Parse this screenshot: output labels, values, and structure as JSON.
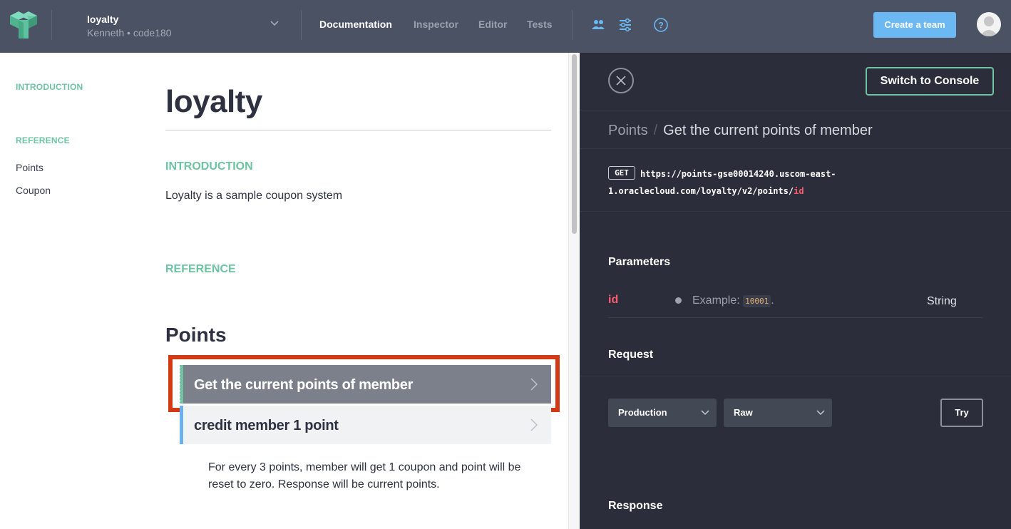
{
  "header": {
    "project_name": "loyalty",
    "project_subtitle": "Kenneth • code180",
    "nav": [
      "Documentation",
      "Inspector",
      "Editor",
      "Tests"
    ],
    "active_nav": "Documentation",
    "create_team_label": "Create a team",
    "icons": [
      "team-icon",
      "settings-sliders-icon",
      "help-icon"
    ]
  },
  "sidebar": {
    "intro_heading": "INTRODUCTION",
    "reference_heading": "REFERENCE",
    "items": [
      "Points",
      "Coupon"
    ]
  },
  "main": {
    "title": "loyalty",
    "intro_label": "INTRODUCTION",
    "intro_text": "Loyalty is a sample coupon system",
    "reference_label": "REFERENCE",
    "group_title": "Points",
    "operations": [
      {
        "label": "Get the current points of member",
        "selected": true
      },
      {
        "label": "credit member 1 point",
        "selected": false
      }
    ],
    "operation_description": "For every 3 points, member will get 1 coupon and point will be reset to zero. Response will be current points."
  },
  "inspector": {
    "switch_label": "Switch to Console",
    "breadcrumb_root": "Points",
    "breadcrumb_current": "Get the current points of member",
    "method": "GET",
    "url_base": "https://points-gse00014240.uscom-east-1.oraclecloud.com/loyalty/v2/points/",
    "url_param": "id",
    "parameters_heading": "Parameters",
    "param": {
      "name": "id",
      "example_prefix": "Example:",
      "example_value": "10001",
      "example_suffix": ".",
      "type": "String"
    },
    "request_heading": "Request",
    "environment": "Production",
    "format": "Raw",
    "try_label": "Try",
    "response_heading": "Response"
  },
  "colors": {
    "topbar": "#4a5263",
    "accent_green": "#6dc3a3",
    "accent_blue": "#6cb8f2",
    "panel": "#2b2e3a",
    "highlight": "#d13a14",
    "param_red": "#ff5b6e"
  }
}
